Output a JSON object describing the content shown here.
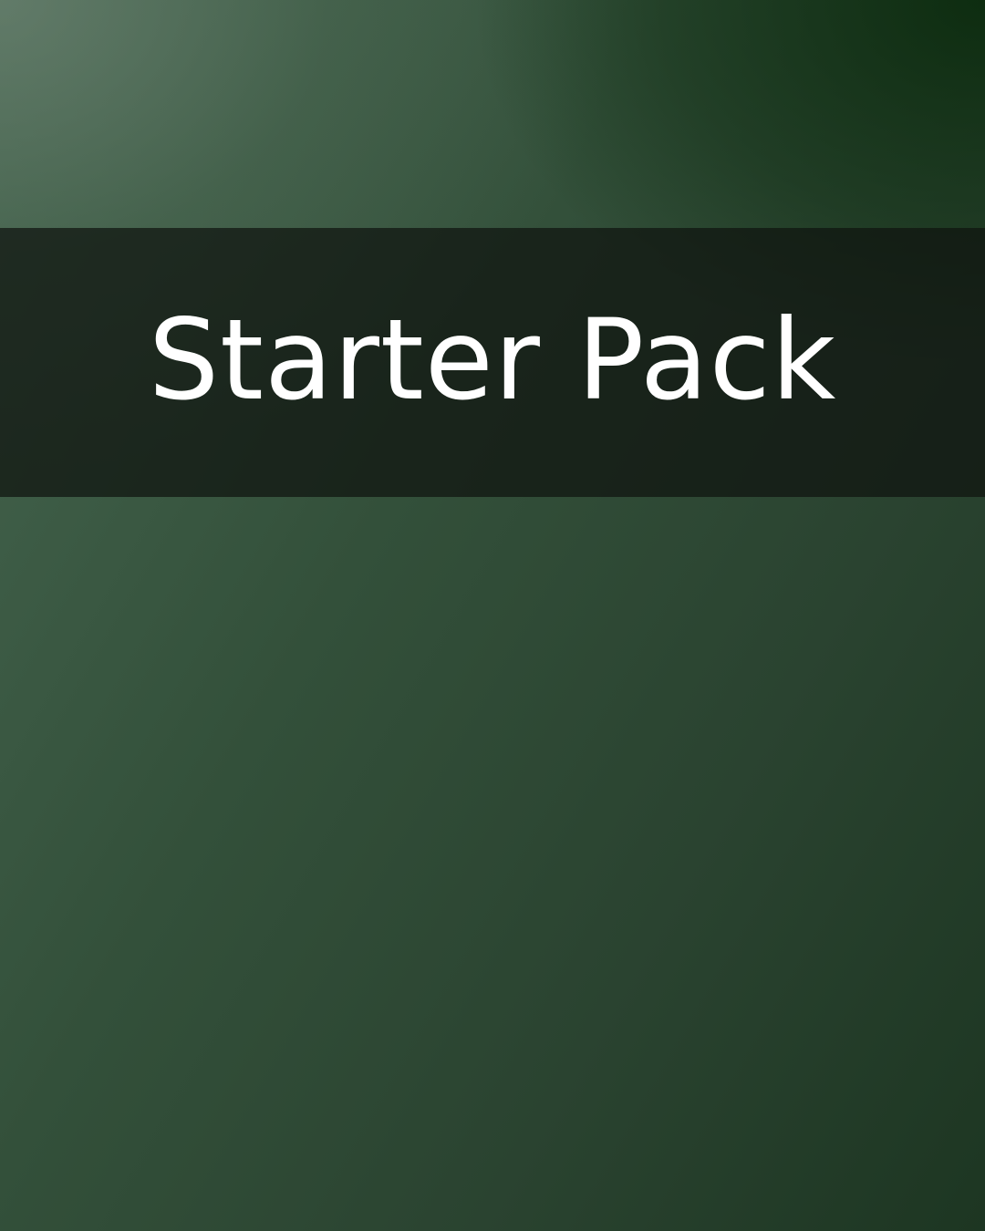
{
  "card": {
    "title": "Starter Pack",
    "colors": {
      "background_light": "#5f7565",
      "background_mid": "#33503a",
      "background_dark": "#0b2a0b",
      "banner": "#1a231b",
      "title_text": "#ffffff"
    }
  }
}
